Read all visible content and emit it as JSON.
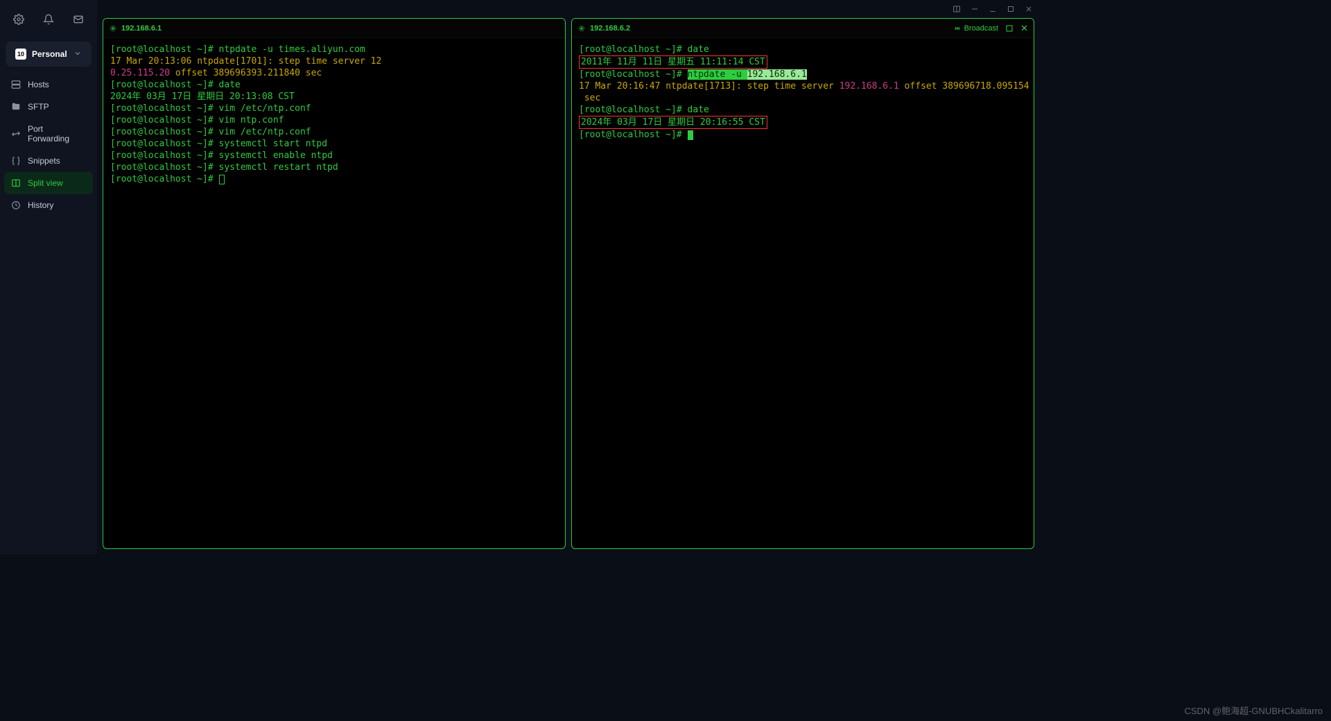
{
  "workspace": {
    "badge": "10",
    "name": "Personal"
  },
  "sidebar": {
    "items": [
      {
        "label": "Hosts"
      },
      {
        "label": "SFTP"
      },
      {
        "label": "Port Forwarding"
      },
      {
        "label": "Snippets"
      },
      {
        "label": "Split view"
      },
      {
        "label": "History"
      }
    ]
  },
  "titlebar": {
    "layout": "layout"
  },
  "panes": {
    "left": {
      "tab": "192.168.6.1",
      "lines": {
        "l1_prompt": "[root@localhost ~]# ",
        "l1_cmd": "ntpdate -u times.aliyun.com",
        "l2": "17 Mar 20:13:06 ntpdate[1701]: step time server 12",
        "l3_ip": "0.25.115.20",
        "l3_rest": " offset 389696393.211840 sec",
        "l4_prompt": "[root@localhost ~]# ",
        "l4_cmd": "date",
        "l5": "2024年 03月 17日 星期日 20:13:08 CST",
        "l6_prompt": "[root@localhost ~]# ",
        "l6_cmd": "vim /etc/ntp.conf",
        "l7_prompt": "[root@localhost ~]# ",
        "l7_cmd": "vim ntp.conf",
        "l8_prompt": "[root@localhost ~]# ",
        "l8_cmd": "vim /etc/ntp.conf",
        "l9_prompt": "[root@localhost ~]# ",
        "l9_cmd": "systemctl start ntpd",
        "l10_prompt": "[root@localhost ~]# ",
        "l10_cmd": "systemctl enable ntpd",
        "l11_prompt": "[root@localhost ~]# ",
        "l11_cmd": "systemctl restart ntpd",
        "l12_prompt": "[root@localhost ~]# "
      }
    },
    "right": {
      "tab": "192.168.6.2",
      "broadcast": "Broadcast",
      "lines": {
        "l1_prompt": "[root@localhost ~]# ",
        "l1_cmd": "date",
        "l2_boxed": "2011年 11月 11日 星期五 11:11:14 CST",
        "l3_prompt": "[root@localhost ~]# ",
        "l3_sel1": "ntpdate -u ",
        "l3_sel2": "192.168.6.1",
        "l4_a": "17 Mar 20:16:47 ntpdate[1713]: step time server ",
        "l4_ip": "192.168.6.1",
        "l4_b": " offset 389696718.095154",
        "l5": " sec",
        "l6_prompt": "[root@localhost ~]# ",
        "l6_cmd": "date",
        "l7_boxed": "2024年 03月 17日 星期日 20:16:55 CST",
        "l8_prompt": "[root@localhost ~]# "
      }
    }
  },
  "watermark": "CSDN @鲍海超-GNUBHCkalitarro"
}
